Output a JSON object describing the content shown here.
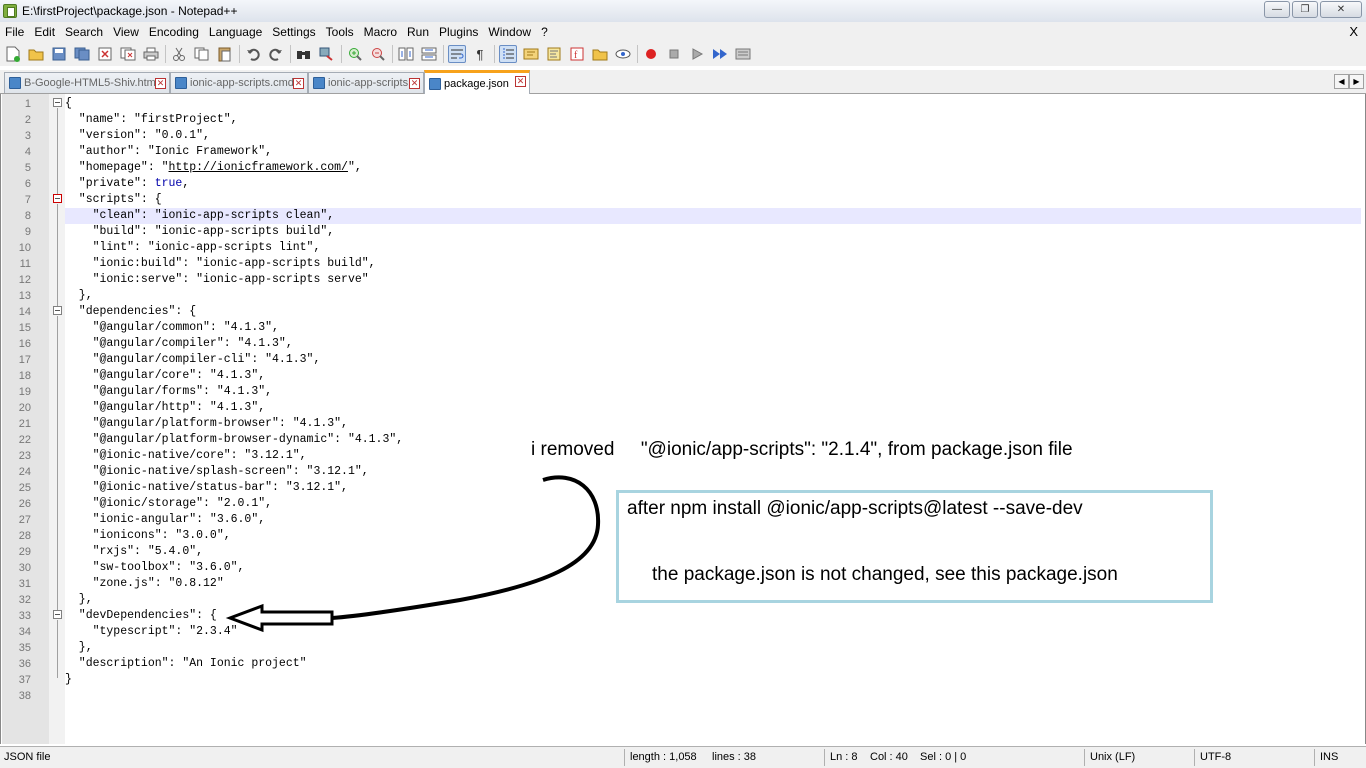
{
  "window": {
    "title": "E:\\firstProject\\package.json - Notepad++",
    "minimize": "—",
    "maximize": "❐",
    "close": "✕"
  },
  "menu": {
    "items": [
      "File",
      "Edit",
      "Search",
      "View",
      "Encoding",
      "Language",
      "Settings",
      "Tools",
      "Macro",
      "Run",
      "Plugins",
      "Window",
      "?"
    ],
    "close": "X"
  },
  "tabs": [
    {
      "label": "B-Google-HTML5-Shiv.html",
      "active": false
    },
    {
      "label": "ionic-app-scripts.cmd",
      "active": false
    },
    {
      "label": "ionic-app-scripts",
      "active": false
    },
    {
      "label": "package.json",
      "active": true
    }
  ],
  "tab_scroll": {
    "left": "◀",
    "right": "▶"
  },
  "editor": {
    "current_line": 8,
    "lines": [
      {
        "n": "1",
        "text": "{"
      },
      {
        "n": "2",
        "text": "  \"name\": \"firstProject\","
      },
      {
        "n": "3",
        "text": "  \"version\": \"0.0.1\","
      },
      {
        "n": "4",
        "text": "  \"author\": \"Ionic Framework\","
      },
      {
        "n": "5",
        "pre": "  \"homepage\": \"",
        "url": "http://ionicframework.com/",
        "post": "\","
      },
      {
        "n": "6",
        "pre": "  \"private\": ",
        "kw": "true",
        "post": ","
      },
      {
        "n": "7",
        "text": "  \"scripts\": {"
      },
      {
        "n": "8",
        "text": "    \"clean\": \"ionic-app-scripts clean\","
      },
      {
        "n": "9",
        "text": "    \"build\": \"ionic-app-scripts build\","
      },
      {
        "n": "10",
        "text": "    \"lint\": \"ionic-app-scripts lint\","
      },
      {
        "n": "11",
        "text": "    \"ionic:build\": \"ionic-app-scripts build\","
      },
      {
        "n": "12",
        "text": "    \"ionic:serve\": \"ionic-app-scripts serve\""
      },
      {
        "n": "13",
        "text": "  },"
      },
      {
        "n": "14",
        "text": "  \"dependencies\": {"
      },
      {
        "n": "15",
        "text": "    \"@angular/common\": \"4.1.3\","
      },
      {
        "n": "16",
        "text": "    \"@angular/compiler\": \"4.1.3\","
      },
      {
        "n": "17",
        "text": "    \"@angular/compiler-cli\": \"4.1.3\","
      },
      {
        "n": "18",
        "text": "    \"@angular/core\": \"4.1.3\","
      },
      {
        "n": "19",
        "text": "    \"@angular/forms\": \"4.1.3\","
      },
      {
        "n": "20",
        "text": "    \"@angular/http\": \"4.1.3\","
      },
      {
        "n": "21",
        "text": "    \"@angular/platform-browser\": \"4.1.3\","
      },
      {
        "n": "22",
        "text": "    \"@angular/platform-browser-dynamic\": \"4.1.3\","
      },
      {
        "n": "23",
        "text": "    \"@ionic-native/core\": \"3.12.1\","
      },
      {
        "n": "24",
        "text": "    \"@ionic-native/splash-screen\": \"3.12.1\","
      },
      {
        "n": "25",
        "text": "    \"@ionic-native/status-bar\": \"3.12.1\","
      },
      {
        "n": "26",
        "text": "    \"@ionic/storage\": \"2.0.1\","
      },
      {
        "n": "27",
        "text": "    \"ionic-angular\": \"3.6.0\","
      },
      {
        "n": "28",
        "text": "    \"ionicons\": \"3.0.0\","
      },
      {
        "n": "29",
        "text": "    \"rxjs\": \"5.4.0\","
      },
      {
        "n": "30",
        "text": "    \"sw-toolbox\": \"3.6.0\","
      },
      {
        "n": "31",
        "text": "    \"zone.js\": \"0.8.12\""
      },
      {
        "n": "32",
        "text": "  },"
      },
      {
        "n": "33",
        "text": "  \"devDependencies\": {"
      },
      {
        "n": "34",
        "text": "    \"typescript\": \"2.3.4\""
      },
      {
        "n": "35",
        "text": "  },"
      },
      {
        "n": "36",
        "text": "  \"description\": \"An Ionic project\""
      },
      {
        "n": "37",
        "text": "}"
      },
      {
        "n": "38",
        "text": ""
      }
    ]
  },
  "annotation": {
    "removed_note": "i removed     \"@ionic/app-scripts\": \"2.1.4\", from package.json file",
    "install_note": "after npm install @ionic/app-scripts@latest --save-dev",
    "result_note": "the package.json is not changed, see this package.json"
  },
  "statusbar": {
    "file_type": "JSON file",
    "length": "length : 1,058",
    "lines": "lines : 38",
    "ln": "Ln : 8",
    "col": "Col : 40",
    "sel": "Sel : 0 | 0",
    "eol": "Unix (LF)",
    "encoding": "UTF-8",
    "mode": "INS"
  },
  "colors": {
    "keyword": "#0000aa",
    "current_line": "#e8e8ff",
    "active_tab_accent": "#f7a21b",
    "note_box_border": "#a8d4e0"
  }
}
